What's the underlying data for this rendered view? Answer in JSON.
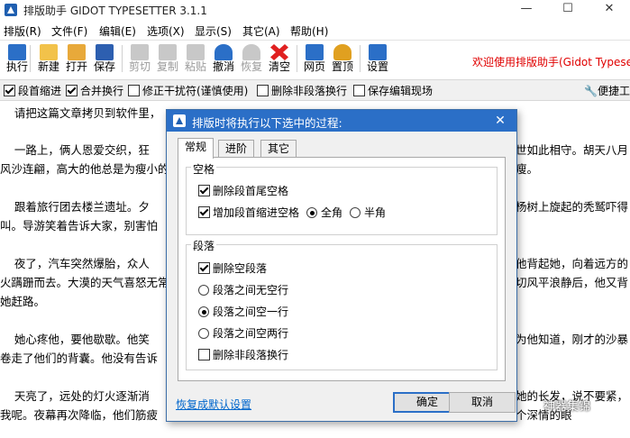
{
  "window": {
    "title": "排版助手 GIDOT TYPESETTER 3.1.1",
    "controls": [
      "—",
      "☐",
      "✕"
    ]
  },
  "menu": [
    "排版(R)",
    "文件(F)",
    "编辑(E)",
    "选项(X)",
    "显示(S)",
    "其它(A)",
    "帮助(H)"
  ],
  "toolbar": {
    "buttons": [
      {
        "label": "执行",
        "icon": "run-icon",
        "color": "#2b6fc7"
      },
      {
        "label": "新建",
        "icon": "new-file-icon",
        "color": "#f2c24a"
      },
      {
        "label": "打开",
        "icon": "open-folder-icon",
        "color": "#e8a93a"
      },
      {
        "label": "保存",
        "icon": "save-icon",
        "color": "#2d5fb0"
      },
      {
        "label": "剪切",
        "icon": "cut-icon",
        "color": "#9a9a9a"
      },
      {
        "label": "复制",
        "icon": "copy-icon",
        "color": "#a8a8a8"
      },
      {
        "label": "粘贴",
        "icon": "paste-icon",
        "color": "#a8a8a8"
      },
      {
        "label": "撤消",
        "icon": "undo-icon",
        "color": "#2b6fc7"
      },
      {
        "label": "恢复",
        "icon": "redo-icon",
        "color": "#9a9a9a"
      },
      {
        "label": "清空",
        "icon": "clear-icon",
        "color": "#e02020"
      },
      {
        "label": "网页",
        "icon": "webpage-icon",
        "color": "#2b6fc7"
      },
      {
        "label": "置顶",
        "icon": "pin-top-icon",
        "color": "#e0a020"
      },
      {
        "label": "设置",
        "icon": "settings-icon",
        "color": "#2b6fc7"
      }
    ],
    "welcome": "欢迎使用排版助手(Gidot Typese"
  },
  "options": [
    {
      "label": "段首缩进",
      "checked": true
    },
    {
      "label": "合并换行",
      "checked": true
    },
    {
      "label": "修正干扰符(谨慎使用)",
      "checked": false
    },
    {
      "label": "删除非段落换行",
      "checked": false
    },
    {
      "label": "保存编辑现场",
      "checked": false
    }
  ],
  "quick_tool": "便捷工",
  "document": [
    "    请把这篇文章拷贝到软件里，",
    "    一路上，俩人恩爱交织，狂",
    "风沙连翩，高大的他总是为瘦小的",
    "    跟着旅行团去楼兰遗址。夕",
    "叫。导游笑着告诉大家，别害怕",
    "    夜了，汽车突然爆胎，众人",
    "火蹒跚而去。大漠的天气喜怒无常",
    "她赶路。",
    "    她心疼他，要他歇歇。他笑",
    "卷走了他们的背囊。他没有告诉",
    "    天亮了，远处的灯火逐渐消",
    "我呢。夜幕再次降临，他们筋疲"
  ],
  "document_right": [
    "世如此相守。胡天八月",
    "瘦。",
    "杨树上旋起的秃鹫吓得",
    "他背起她，向着远方的",
    "切风平浪静后，他又背",
    "为他知道，刚才的沙暴",
    "她的长发，说不要紧，",
    "个深情的眼"
  ],
  "dialog": {
    "title": "排版时将执行以下选中的过程:",
    "tabs": [
      "常规",
      "进阶",
      "其它"
    ],
    "group_spacing": {
      "label": "空格",
      "items": [
        {
          "label": "删除段首尾空格",
          "checked": true
        },
        {
          "label": "增加段首缩进空格",
          "checked": true
        }
      ],
      "radios": [
        {
          "label": "全角",
          "selected": true
        },
        {
          "label": "半角",
          "selected": false
        }
      ]
    },
    "group_paragraph": {
      "label": "段落",
      "checkbox_top": {
        "label": "删除空段落",
        "checked": true
      },
      "radios": [
        {
          "label": "段落之间无空行",
          "selected": false
        },
        {
          "label": "段落之间空一行",
          "selected": true
        },
        {
          "label": "段落之间空两行",
          "selected": false
        }
      ],
      "checkbox_bottom": {
        "label": "删除非段落换行",
        "checked": false
      }
    },
    "restore_link": "恢复成默认设置",
    "ok": "确定",
    "cancel": "取消"
  },
  "watermark": "神器集锦"
}
